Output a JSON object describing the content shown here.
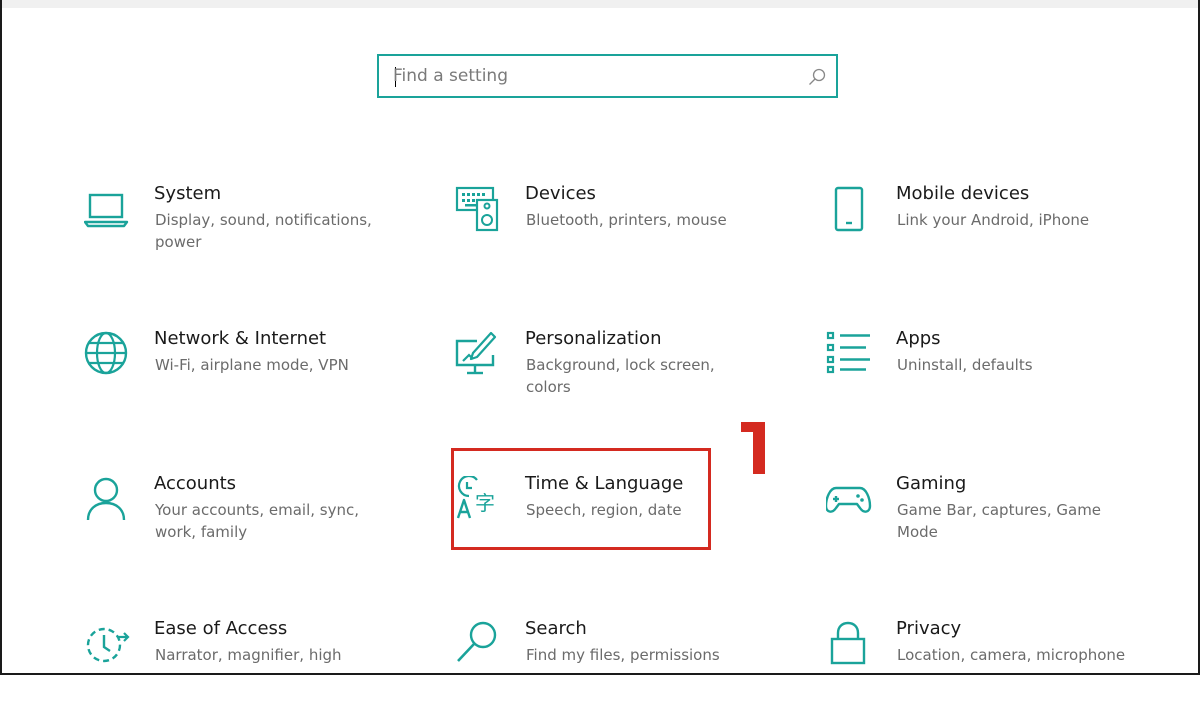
{
  "search": {
    "placeholder": "Find a setting",
    "value": ""
  },
  "tiles": [
    {
      "title": "System",
      "desc": "Display, sound, notifications, power",
      "icon": "laptop-icon"
    },
    {
      "title": "Devices",
      "desc": "Bluetooth, printers, mouse",
      "icon": "keyboard-speaker-icon"
    },
    {
      "title": "Mobile devices",
      "desc": "Link your Android, iPhone",
      "icon": "phone-icon"
    },
    {
      "title": "Network & Internet",
      "desc": "Wi-Fi, airplane mode, VPN",
      "icon": "globe-icon"
    },
    {
      "title": "Personalization",
      "desc": "Background, lock screen, colors",
      "icon": "paint-monitor-icon"
    },
    {
      "title": "Apps",
      "desc": "Uninstall, defaults",
      "icon": "list-icon"
    },
    {
      "title": "Accounts",
      "desc": "Your accounts, email, sync, work, family",
      "icon": "person-icon"
    },
    {
      "title": "Time & Language",
      "desc": "Speech, region, date",
      "icon": "time-language-icon"
    },
    {
      "title": "Gaming",
      "desc": "Game Bar, captures, Game Mode",
      "icon": "gamepad-icon"
    },
    {
      "title": "Ease of Access",
      "desc": "Narrator, magnifier, high",
      "icon": "ease-access-icon"
    },
    {
      "title": "Search",
      "desc": "Find my files, permissions",
      "icon": "search-icon"
    },
    {
      "title": "Privacy",
      "desc": "Location, camera, microphone",
      "icon": "lock-icon"
    }
  ],
  "annotation": {
    "number": "1",
    "color": "#d42a20"
  },
  "colors": {
    "accent": "#1aa39a",
    "highlight": "#d42a20"
  }
}
